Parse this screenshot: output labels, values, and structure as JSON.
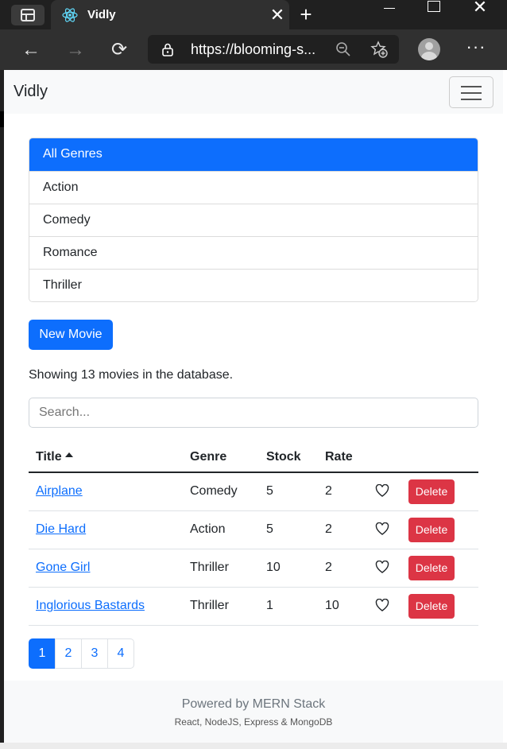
{
  "browser": {
    "tab_title": "Vidly",
    "new_tab_label": "+",
    "url": "https://blooming-s...",
    "more_label": "···"
  },
  "app": {
    "brand": "Vidly"
  },
  "genres": {
    "items": [
      {
        "label": "All Genres",
        "active": true
      },
      {
        "label": "Action",
        "active": false
      },
      {
        "label": "Comedy",
        "active": false
      },
      {
        "label": "Romance",
        "active": false
      },
      {
        "label": "Thriller",
        "active": false
      }
    ]
  },
  "actions": {
    "new_movie_label": "New Movie"
  },
  "summary": {
    "text": "Showing 13 movies in the database."
  },
  "search": {
    "placeholder": "Search..."
  },
  "table": {
    "headers": {
      "title": "Title",
      "genre": "Genre",
      "stock": "Stock",
      "rate": "Rate"
    },
    "delete_label": "Delete",
    "rows": [
      {
        "title": "Airplane",
        "genre": "Comedy",
        "stock": "5",
        "rate": "2"
      },
      {
        "title": "Die Hard",
        "genre": "Action",
        "stock": "5",
        "rate": "2"
      },
      {
        "title": "Gone Girl",
        "genre": "Thriller",
        "stock": "10",
        "rate": "2"
      },
      {
        "title": "Inglorious Bastards",
        "genre": "Thriller",
        "stock": "1",
        "rate": "10"
      }
    ]
  },
  "pagination": {
    "pages": [
      "1",
      "2",
      "3",
      "4"
    ],
    "current": "1"
  },
  "footer": {
    "title": "Powered by MERN Stack",
    "subtitle": "React, NodeJS, Express & MongoDB"
  },
  "colors": {
    "primary": "#0d6efd",
    "danger": "#dc3545",
    "navbar_bg": "#f8f9fa",
    "browser_dark": "#202020"
  }
}
